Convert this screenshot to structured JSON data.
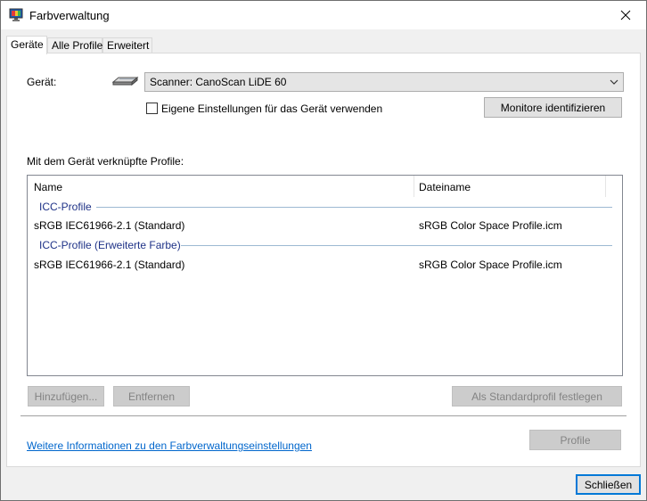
{
  "window": {
    "title": "Farbverwaltung",
    "close_symbol": "✕"
  },
  "tabs": [
    {
      "label": "Geräte",
      "active": true
    },
    {
      "label": "Alle Profile",
      "active": false
    },
    {
      "label": "Erweitert",
      "active": false
    }
  ],
  "device": {
    "label": "Gerät:",
    "icon": "scanner-icon",
    "selected": "Scanner: CanoScan LiDE 60",
    "use_own_settings_label": "Eigene Einstellungen für das Gerät verwenden",
    "use_own_settings_checked": false,
    "identify_monitors_label": "Monitore identifizieren"
  },
  "profiles": {
    "heading": "Mit dem Gerät verknüpfte Profile:",
    "columns": [
      "Name",
      "Dateiname"
    ],
    "groups": [
      {
        "label": "ICC-Profile",
        "rows": [
          {
            "name": "sRGB IEC61966-2.1 (Standard)",
            "file": "sRGB Color Space Profile.icm"
          }
        ]
      },
      {
        "label": "ICC-Profile (Erweiterte Farbe)",
        "rows": [
          {
            "name": "sRGB IEC61966-2.1 (Standard)",
            "file": "sRGB Color Space Profile.icm"
          }
        ]
      }
    ]
  },
  "actions": {
    "add_label": "Hinzufügen...",
    "remove_label": "Entfernen",
    "set_default_label": "Als Standardprofil festlegen",
    "profile_label": "Profile"
  },
  "footer": {
    "info_link": "Weitere Informationen zu den Farbverwaltungseinstellungen",
    "close_label": "Schließen"
  },
  "colors": {
    "accent": "#0078d7",
    "group_text": "#1e3287",
    "link": "#0066cc"
  }
}
